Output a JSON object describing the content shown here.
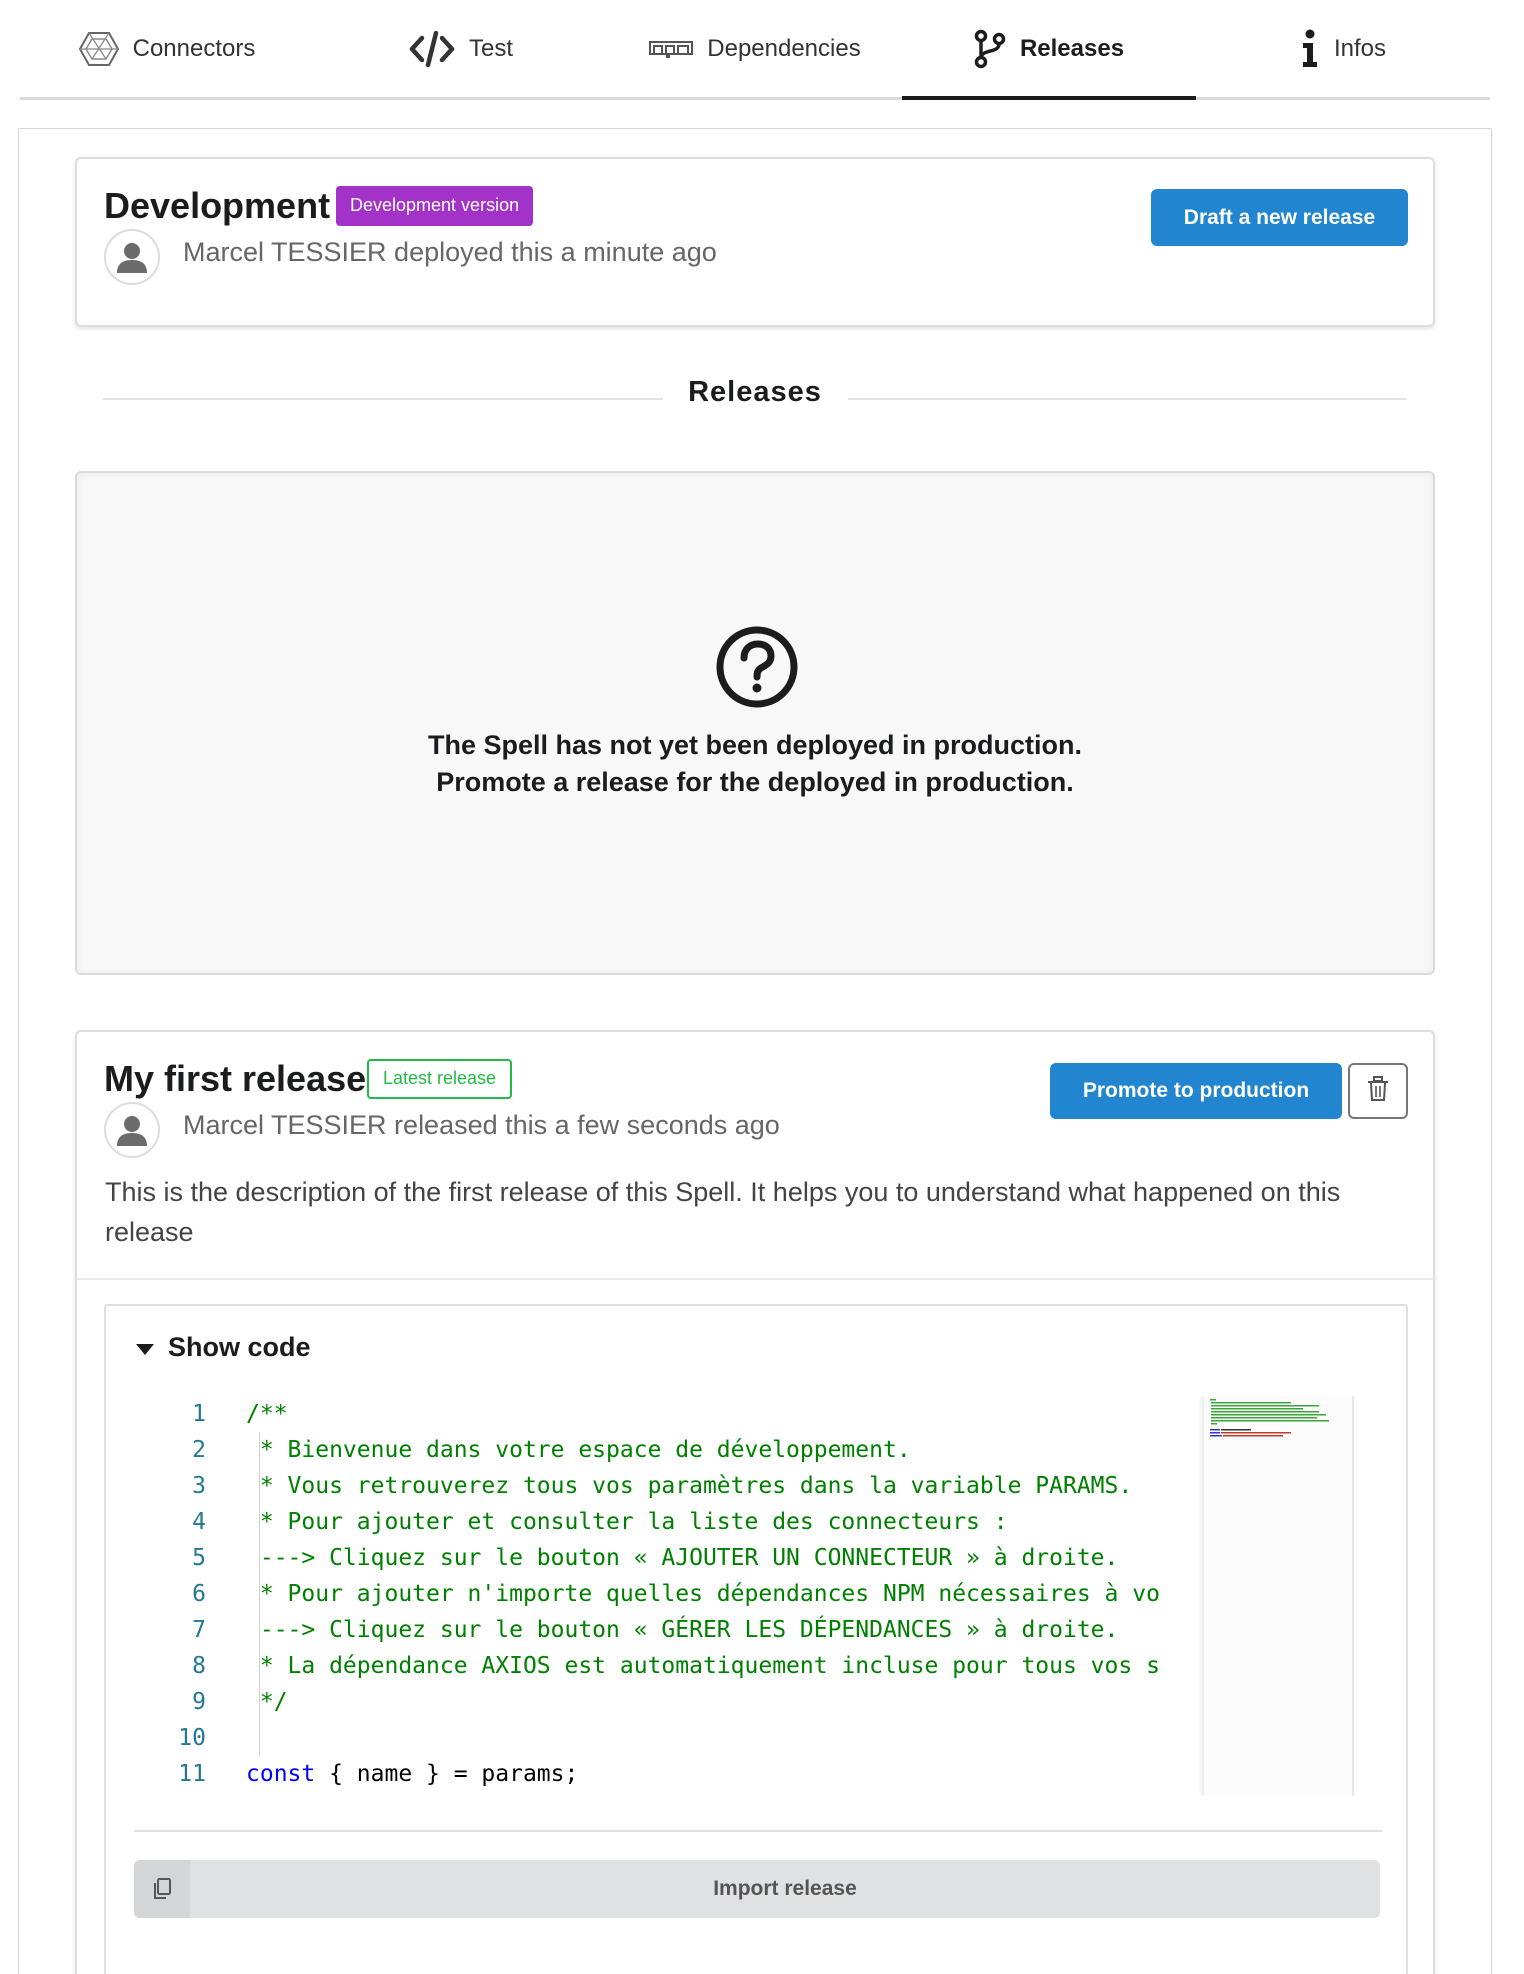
{
  "tabs": [
    {
      "label": "Connectors",
      "icon": "connectors-icon",
      "active": false
    },
    {
      "label": "Test",
      "icon": "code-icon",
      "active": false
    },
    {
      "label": "Dependencies",
      "icon": "npm-icon",
      "active": false
    },
    {
      "label": "Releases",
      "icon": "code-branch-icon",
      "active": true
    },
    {
      "label": "Infos",
      "icon": "info-icon",
      "active": false
    }
  ],
  "development": {
    "title": "Development",
    "badge": "Development version",
    "meta": "Marcel TESSIER deployed this a minute ago",
    "draft_button": "Draft a new release"
  },
  "releases_heading": "Releases",
  "production_placeholder": {
    "icon": "question-circle-icon",
    "line1": "The Spell has not yet been deployed in production.",
    "line2": "Promote a release for the deployed in production."
  },
  "release": {
    "title": "My first release",
    "badge": "Latest release",
    "meta": "Marcel TESSIER released this a few seconds ago",
    "promote_button": "Promote to production",
    "delete_icon": "trash-icon",
    "description": "This is the description of the first release of this Spell. It helps you to understand what happened on this release",
    "show_code_label": "Show code",
    "code_lines": [
      {
        "n": "1",
        "text": "/**",
        "kind": "comment"
      },
      {
        "n": "2",
        "text": " * Bienvenue dans votre espace de développement.",
        "kind": "comment"
      },
      {
        "n": "3",
        "text": " * Vous retrouverez tous vos paramètres dans la variable PARAMS.",
        "kind": "comment"
      },
      {
        "n": "4",
        "text": " * Pour ajouter et consulter la liste des connecteurs :",
        "kind": "comment"
      },
      {
        "n": "5",
        "text": " ---> Cliquez sur le bouton « AJOUTER UN CONNECTEUR » à droite.",
        "kind": "comment"
      },
      {
        "n": "6",
        "text": " * Pour ajouter n'importe quelles dépendances NPM nécessaires à vo",
        "kind": "comment"
      },
      {
        "n": "7",
        "text": " ---> Cliquez sur le bouton « GÉRER LES DÉPENDANCES » à droite.",
        "kind": "comment"
      },
      {
        "n": "8",
        "text": " * La dépendance AXIOS est automatiquement incluse pour tous vos s",
        "kind": "comment"
      },
      {
        "n": "9",
        "text": " */",
        "kind": "comment"
      },
      {
        "n": "10",
        "text": "",
        "kind": "plain"
      },
      {
        "n": "11",
        "keyword": "const",
        "rest": " { name } = params;",
        "kind": "code"
      }
    ],
    "import_button": "Import release",
    "import_icon": "copy-icon"
  },
  "colors": {
    "primary": "#2185d0",
    "purple": "#a333c8",
    "green": "#21ba45",
    "comment": "#008000",
    "keyword": "#0000ff",
    "line_number": "#237893"
  }
}
